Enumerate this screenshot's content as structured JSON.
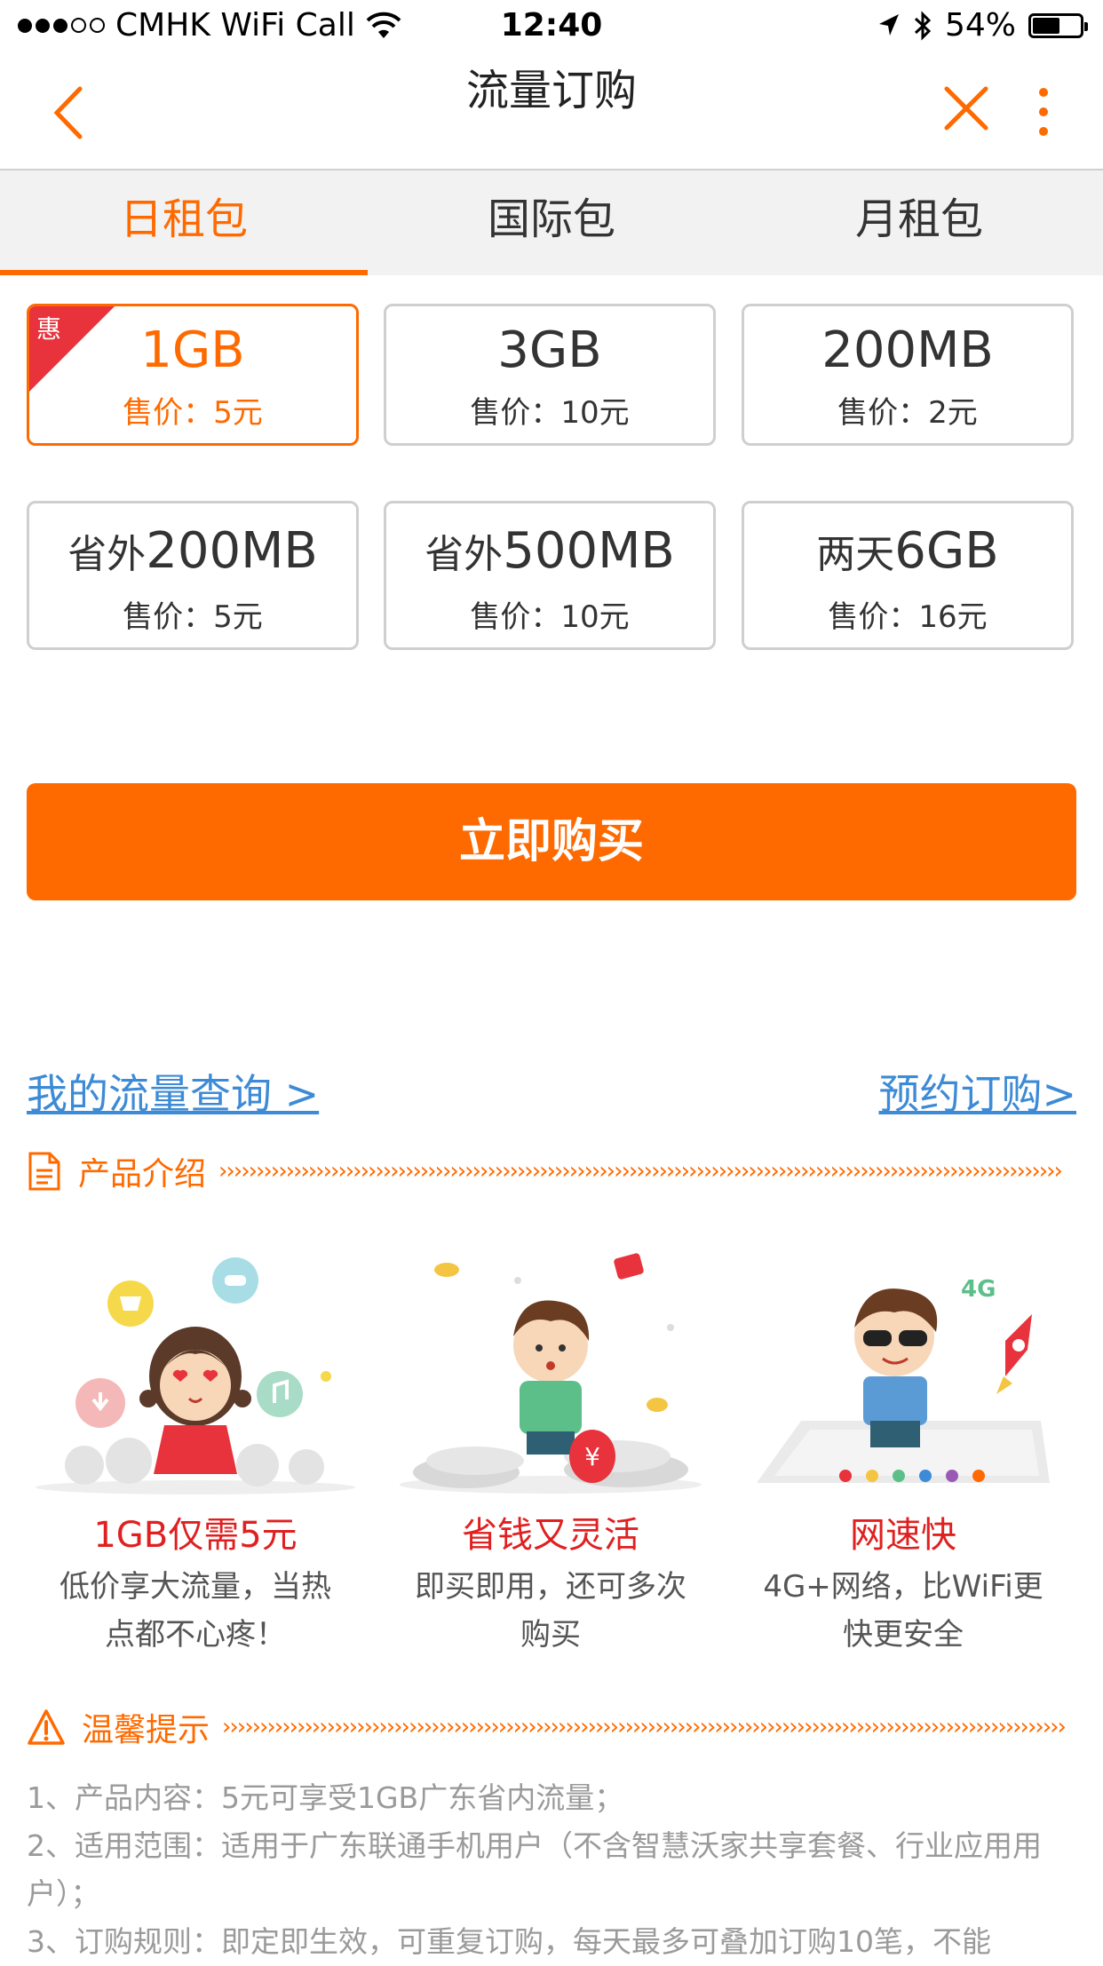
{
  "status_bar": {
    "carrier": "CMHK WiFi Call",
    "time": "12:40",
    "battery": "54%",
    "battery_level": 0.54
  },
  "nav": {
    "title": "流量订购"
  },
  "tabs": [
    {
      "label": "日租包",
      "active": true
    },
    {
      "label": "国际包",
      "active": false
    },
    {
      "label": "月租包",
      "active": false
    }
  ],
  "packages": [
    {
      "prefix": "",
      "amount": "1GB",
      "price": "售价：5元",
      "selected": true,
      "badge": "惠"
    },
    {
      "prefix": "",
      "amount": "3GB",
      "price": "售价：10元",
      "selected": false
    },
    {
      "prefix": "",
      "amount": "200MB",
      "price": "售价：2元",
      "selected": false
    },
    {
      "prefix": "省外",
      "amount": "200MB",
      "price": "售价：5元",
      "selected": false
    },
    {
      "prefix": "省外",
      "amount": "500MB",
      "price": "售价：10元",
      "selected": false
    },
    {
      "prefix": "两天",
      "amount": "6GB",
      "price": "售价：16元",
      "selected": false
    }
  ],
  "buy_button": "立即购买",
  "links": {
    "query": "我的流量查询 >",
    "reserve": "预约订购>"
  },
  "product_intro": {
    "label": "产品介绍",
    "features": [
      {
        "title": "1GB仅需5元",
        "desc_line1": "低价享大流量，当热",
        "desc_line2": "点都不心疼！"
      },
      {
        "title": "省钱又灵活",
        "desc_line1": "即买即用，还可多次",
        "desc_line2": "购买"
      },
      {
        "title": "网速快",
        "desc_line1": "4G+网络，比WiFi更",
        "desc_line2": "快更安全"
      }
    ]
  },
  "tips": {
    "label": "温馨提示",
    "items": [
      "1、产品内容：5元可享受1GB广东省内流量；",
      "2、适用范围：适用于广东联通手机用户（不含智慧沃家共享套餐、行业应用用户）；",
      "3、订购规则：即定即生效，可重复订购，每天最多可叠加订购10笔，不能"
    ]
  },
  "colors": {
    "accent": "#ff6a00",
    "badge": "#e8323c",
    "link": "#3d8bd6",
    "feature_title": "#e02020"
  }
}
